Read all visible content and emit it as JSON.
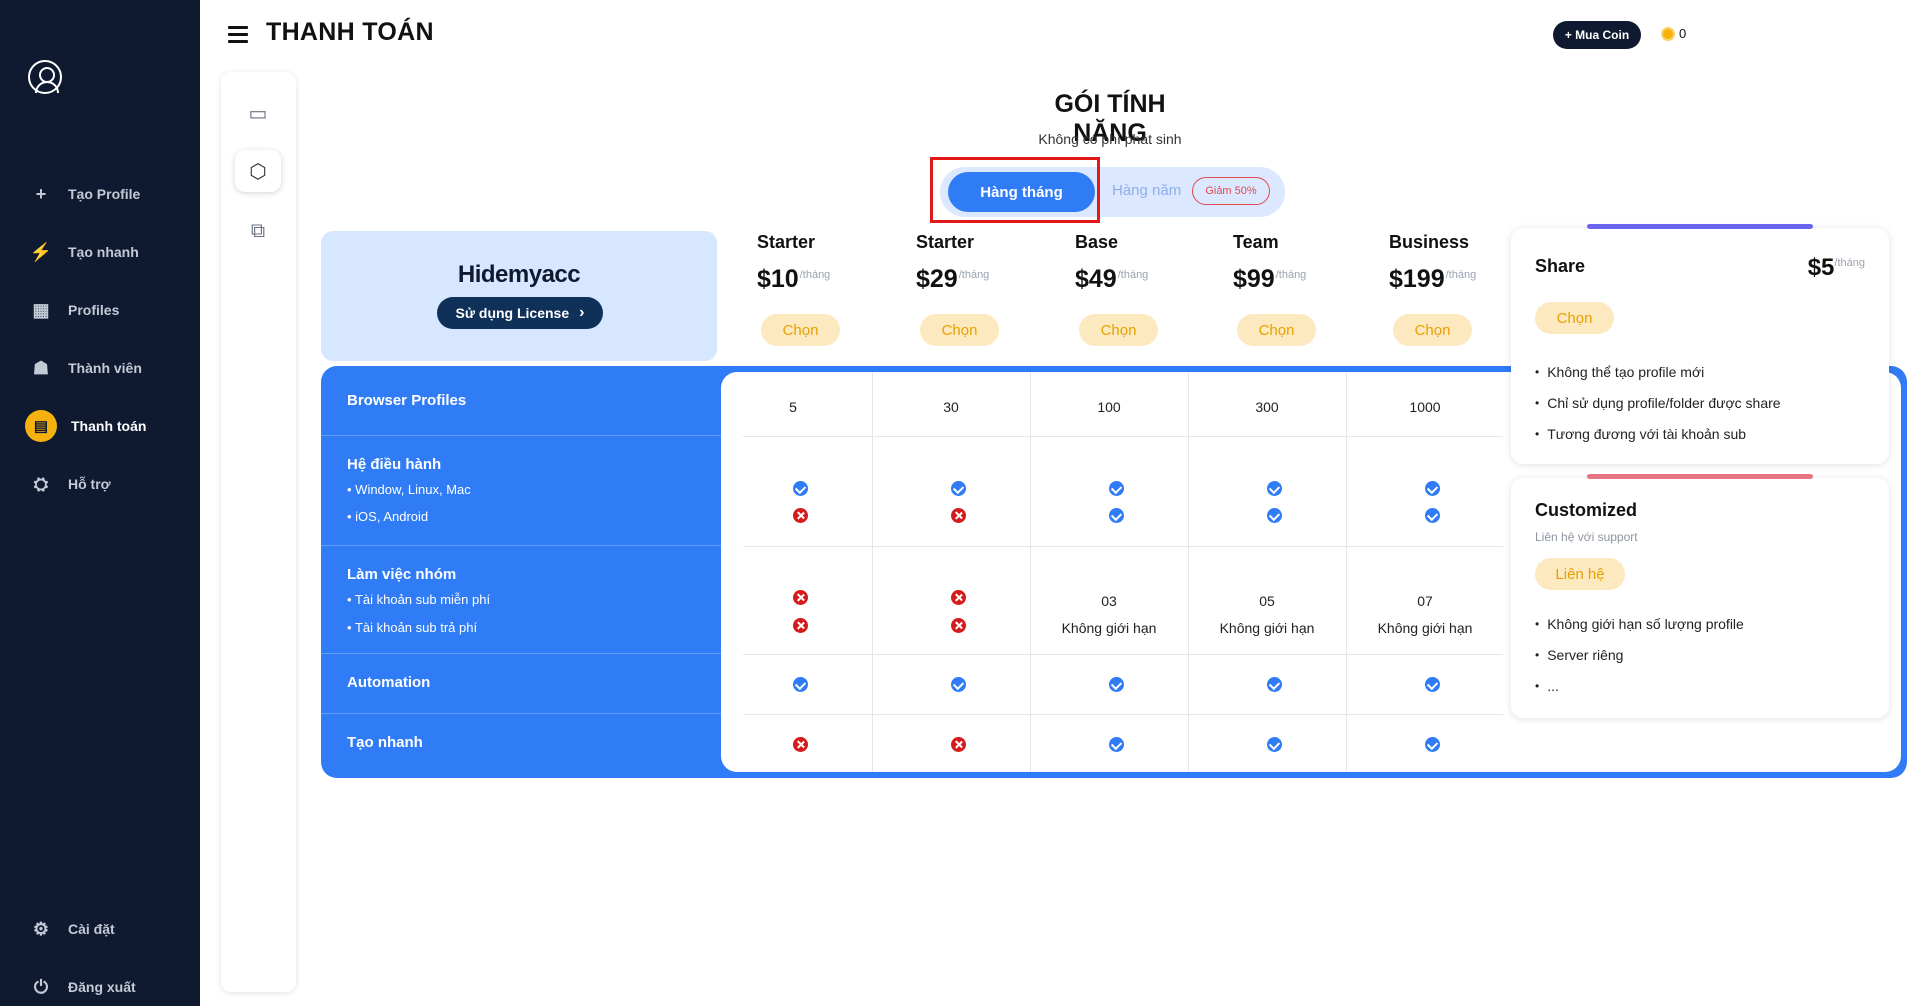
{
  "sidebar": {
    "items": [
      {
        "label": "Tạo Profile",
        "icon": "plus-icon"
      },
      {
        "label": "Tạo nhanh",
        "icon": "lightning-icon"
      },
      {
        "label": "Profiles",
        "icon": "grid-icon"
      },
      {
        "label": "Thành viên",
        "icon": "team-icon"
      },
      {
        "label": "Thanh toán",
        "icon": "payment-icon"
      },
      {
        "label": "Hỗ trợ",
        "icon": "support-icon"
      }
    ],
    "bottom": [
      {
        "label": "Cài đặt",
        "icon": "gear-icon"
      },
      {
        "label": "Đăng xuất",
        "icon": "logout-icon"
      }
    ]
  },
  "header": {
    "title": "THANH TOÁN",
    "buy_coin": "+ Mua Coin",
    "coin_balance": "0"
  },
  "main": {
    "heading": "GÓI TÍNH NĂNG",
    "subheading": "Không có phí phát sinh",
    "toggle": {
      "monthly": "Hàng tháng",
      "yearly": "Hàng năm",
      "discount": "Giảm 50%"
    },
    "logo": "Hidemyacc",
    "license_button": "Sử dụng License",
    "per_label": "/tháng",
    "choose_label": "Chọn",
    "plans": [
      {
        "name": "Starter",
        "price": "$10"
      },
      {
        "name": "Starter",
        "price": "$29"
      },
      {
        "name": "Base",
        "price": "$49"
      },
      {
        "name": "Team",
        "price": "$99"
      },
      {
        "name": "Business",
        "price": "$199"
      }
    ],
    "features": {
      "browser_profiles": {
        "title": "Browser Profiles",
        "values": [
          "5",
          "30",
          "100",
          "300",
          "1000"
        ]
      },
      "os": {
        "title": "Hệ điều hành",
        "subs": [
          "Window, Linux, Mac",
          "iOS, Android"
        ]
      },
      "team": {
        "title": "Làm việc nhóm",
        "subs": [
          "Tài khoản sub miễn phí",
          "Tài khoản sub trả phí"
        ],
        "free_values": [
          "03",
          "05",
          "07"
        ],
        "paid_value": "Không giới hạn"
      },
      "automation": {
        "title": "Automation"
      },
      "quick": {
        "title": "Tạo nhanh"
      }
    },
    "cards": {
      "share": {
        "title": "Share",
        "price": "$5",
        "items": [
          "Không thể tạo profile mới",
          "Chỉ sử dụng profile/folder được share",
          "Tương đương với tài khoản sub"
        ]
      },
      "custom": {
        "title": "Customized",
        "sub": "Liên hệ với support",
        "contact": "Liên hệ",
        "items": [
          "Không giới hạn số lượng profile",
          "Server riêng",
          "..."
        ]
      }
    }
  },
  "colors": {
    "sidebar": "#0f1a30",
    "accent": "#2f7cf6",
    "gold": "#f5b20f",
    "highlight": "#e31818"
  }
}
